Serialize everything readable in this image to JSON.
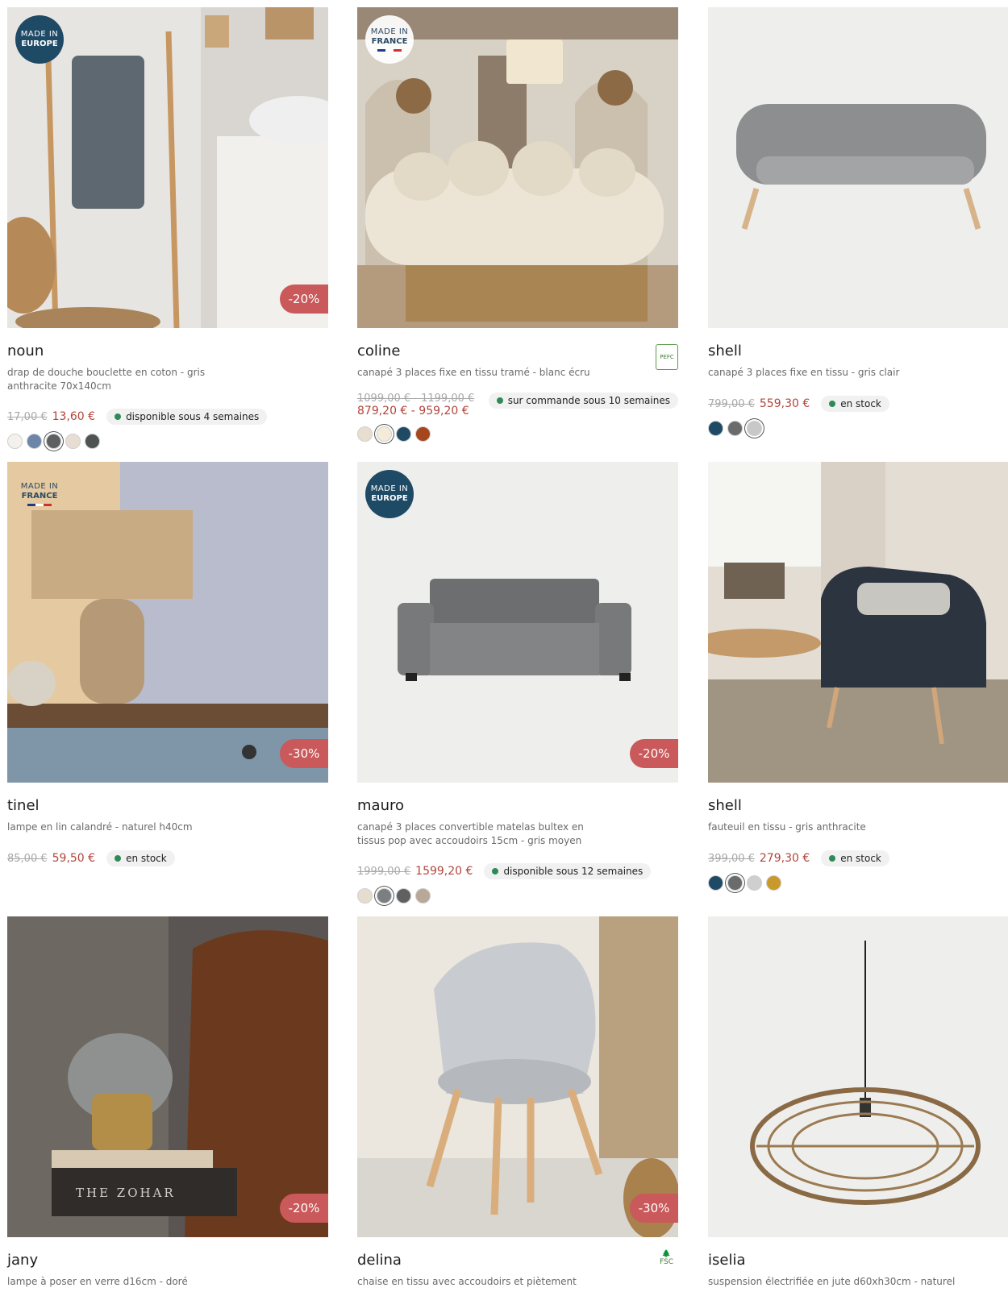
{
  "products": [
    {
      "name": "noun",
      "description": "drap de douche bouclette en coton - gris anthracite 70x140cm",
      "old_price": "17,00 €",
      "price": "13,60 €",
      "stock": "disponible sous 4 semaines",
      "discount": "-20%",
      "badge": {
        "line1": "MADE IN",
        "line2": "EUROPE"
      },
      "image": "grey-towel-on-wooden-ladder-photo",
      "swatches": [
        "#f3f1ec",
        "#6b86a8",
        "#5e5f61",
        "#e8ddd3",
        "#4d5452"
      ]
    },
    {
      "name": "coline",
      "description": "canapé 3 places fixe en tissu tramé - blanc écru",
      "old_price": "1099,00 € - 1199,00 €",
      "price": "879,20 € - 959,20 €",
      "stock": "sur commande sous 10 semaines",
      "badge": {
        "line1": "MADE IN",
        "line2": "FRANCE"
      },
      "certification": "PEFC",
      "image": "cream-sofa-in-arched-living-room-photo",
      "swatches": [
        "#e8ddcf",
        "#f4ecd8",
        "#1e4a66",
        "#a6461c"
      ]
    },
    {
      "name": "shell",
      "description": "canapé 3 places fixe en tissu - gris clair",
      "old_price": "799,00 €",
      "price": "559,30 €",
      "stock": "en stock",
      "image": "light-grey-sofa-photo",
      "swatches": [
        "#1e4a66",
        "#6a6b6d",
        "#c8c8c8"
      ]
    },
    {
      "name": "tinel",
      "description": "lampe en lin calandré - naturel h40cm",
      "old_price": "85,00 €",
      "price": "59,50 €",
      "stock": "en stock",
      "discount": "-30%",
      "badge": {
        "line1": "MADE IN",
        "line2": "FRANCE"
      },
      "image": "linen-table-lamp-photo",
      "swatches": []
    },
    {
      "name": "mauro",
      "description": "canapé 3 places convertible matelas bultex en tissus pop avec accoudoirs 15cm - gris moyen",
      "old_price": "1999,00 €",
      "price": "1599,20 €",
      "stock": "disponible sous 12 semaines",
      "discount": "-20%",
      "badge": {
        "line1": "MADE IN",
        "line2": "EUROPE"
      },
      "image": "grey-convertible-sofa-photo",
      "swatches": [
        "#e6ddd0",
        "#7c7f82",
        "#5f6062",
        "#b9a898"
      ]
    },
    {
      "name": "shell",
      "description": "fauteuil en tissu - gris anthracite",
      "old_price": "399,00 €",
      "price": "279,30 €",
      "stock": "en stock",
      "image": "dark-armchair-living-room-photo",
      "swatches": [
        "#1e4a66",
        "#6a6b6d",
        "#cfcfcf",
        "#c9992c"
      ]
    },
    {
      "name": "jany",
      "description": "lampe à poser en verre d16cm - doré",
      "discount": "-20%",
      "image": "glass-gold-table-lamp-photo",
      "book_title": "THE ZOHAR"
    },
    {
      "name": "delina",
      "description": "chaise en tissu avec accoudoirs et piètement",
      "discount": "-30%",
      "certification": "FSC",
      "image": "grey-armchair-wooden-legs-photo"
    },
    {
      "name": "iselia",
      "description": "suspension électrifiée en jute d60xh30cm - naturel",
      "image": "jute-pendant-light-photo"
    }
  ]
}
